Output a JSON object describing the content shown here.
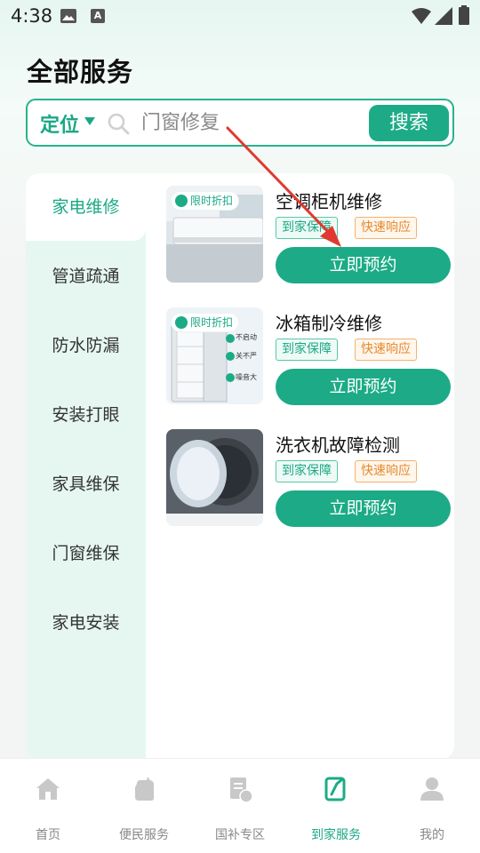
{
  "status_bar": {
    "time": "4:38",
    "a_icon_letter": "A"
  },
  "header": {
    "title": "全部服务"
  },
  "search": {
    "location_label": "定位",
    "placeholder": "门窗修复",
    "button_label": "搜索"
  },
  "sidebar": {
    "items": [
      {
        "label": "家电维修",
        "active": true
      },
      {
        "label": "管道疏通"
      },
      {
        "label": "防水防漏"
      },
      {
        "label": "安装打眼"
      },
      {
        "label": "家具维保"
      },
      {
        "label": "门窗维保"
      },
      {
        "label": "家电安装"
      }
    ]
  },
  "services": [
    {
      "title": "空调柜机维修",
      "badge": "限时折扣",
      "tags": [
        "到家保障",
        "快速响应"
      ],
      "button": "立即预约",
      "image": "air-conditioner"
    },
    {
      "title": "冰箱制冷维修",
      "badge": "限时折扣",
      "tags": [
        "到家保障",
        "快速响应"
      ],
      "button": "立即预约",
      "image": "refrigerator"
    },
    {
      "title": "洗衣机故障检测",
      "tags": [
        "到家保障",
        "快速响应"
      ],
      "button": "立即预约",
      "image": "washing-machine"
    }
  ],
  "fridge_image_labels": [
    "不启动",
    "关不严",
    "噪音大"
  ],
  "bottom_nav": {
    "items": [
      {
        "label": "首页",
        "icon": "home-icon"
      },
      {
        "label": "便民服务",
        "icon": "service-icon"
      },
      {
        "label": "国补专区",
        "icon": "subsidy-icon"
      },
      {
        "label": "到家服务",
        "icon": "home-service-icon",
        "active": true
      },
      {
        "label": "我的",
        "icon": "profile-icon"
      }
    ]
  },
  "colors": {
    "accent": "#1cab86",
    "accent_text": "#1aa884",
    "tag_orange": "#e58a2e",
    "arrow": "#e0392f"
  }
}
